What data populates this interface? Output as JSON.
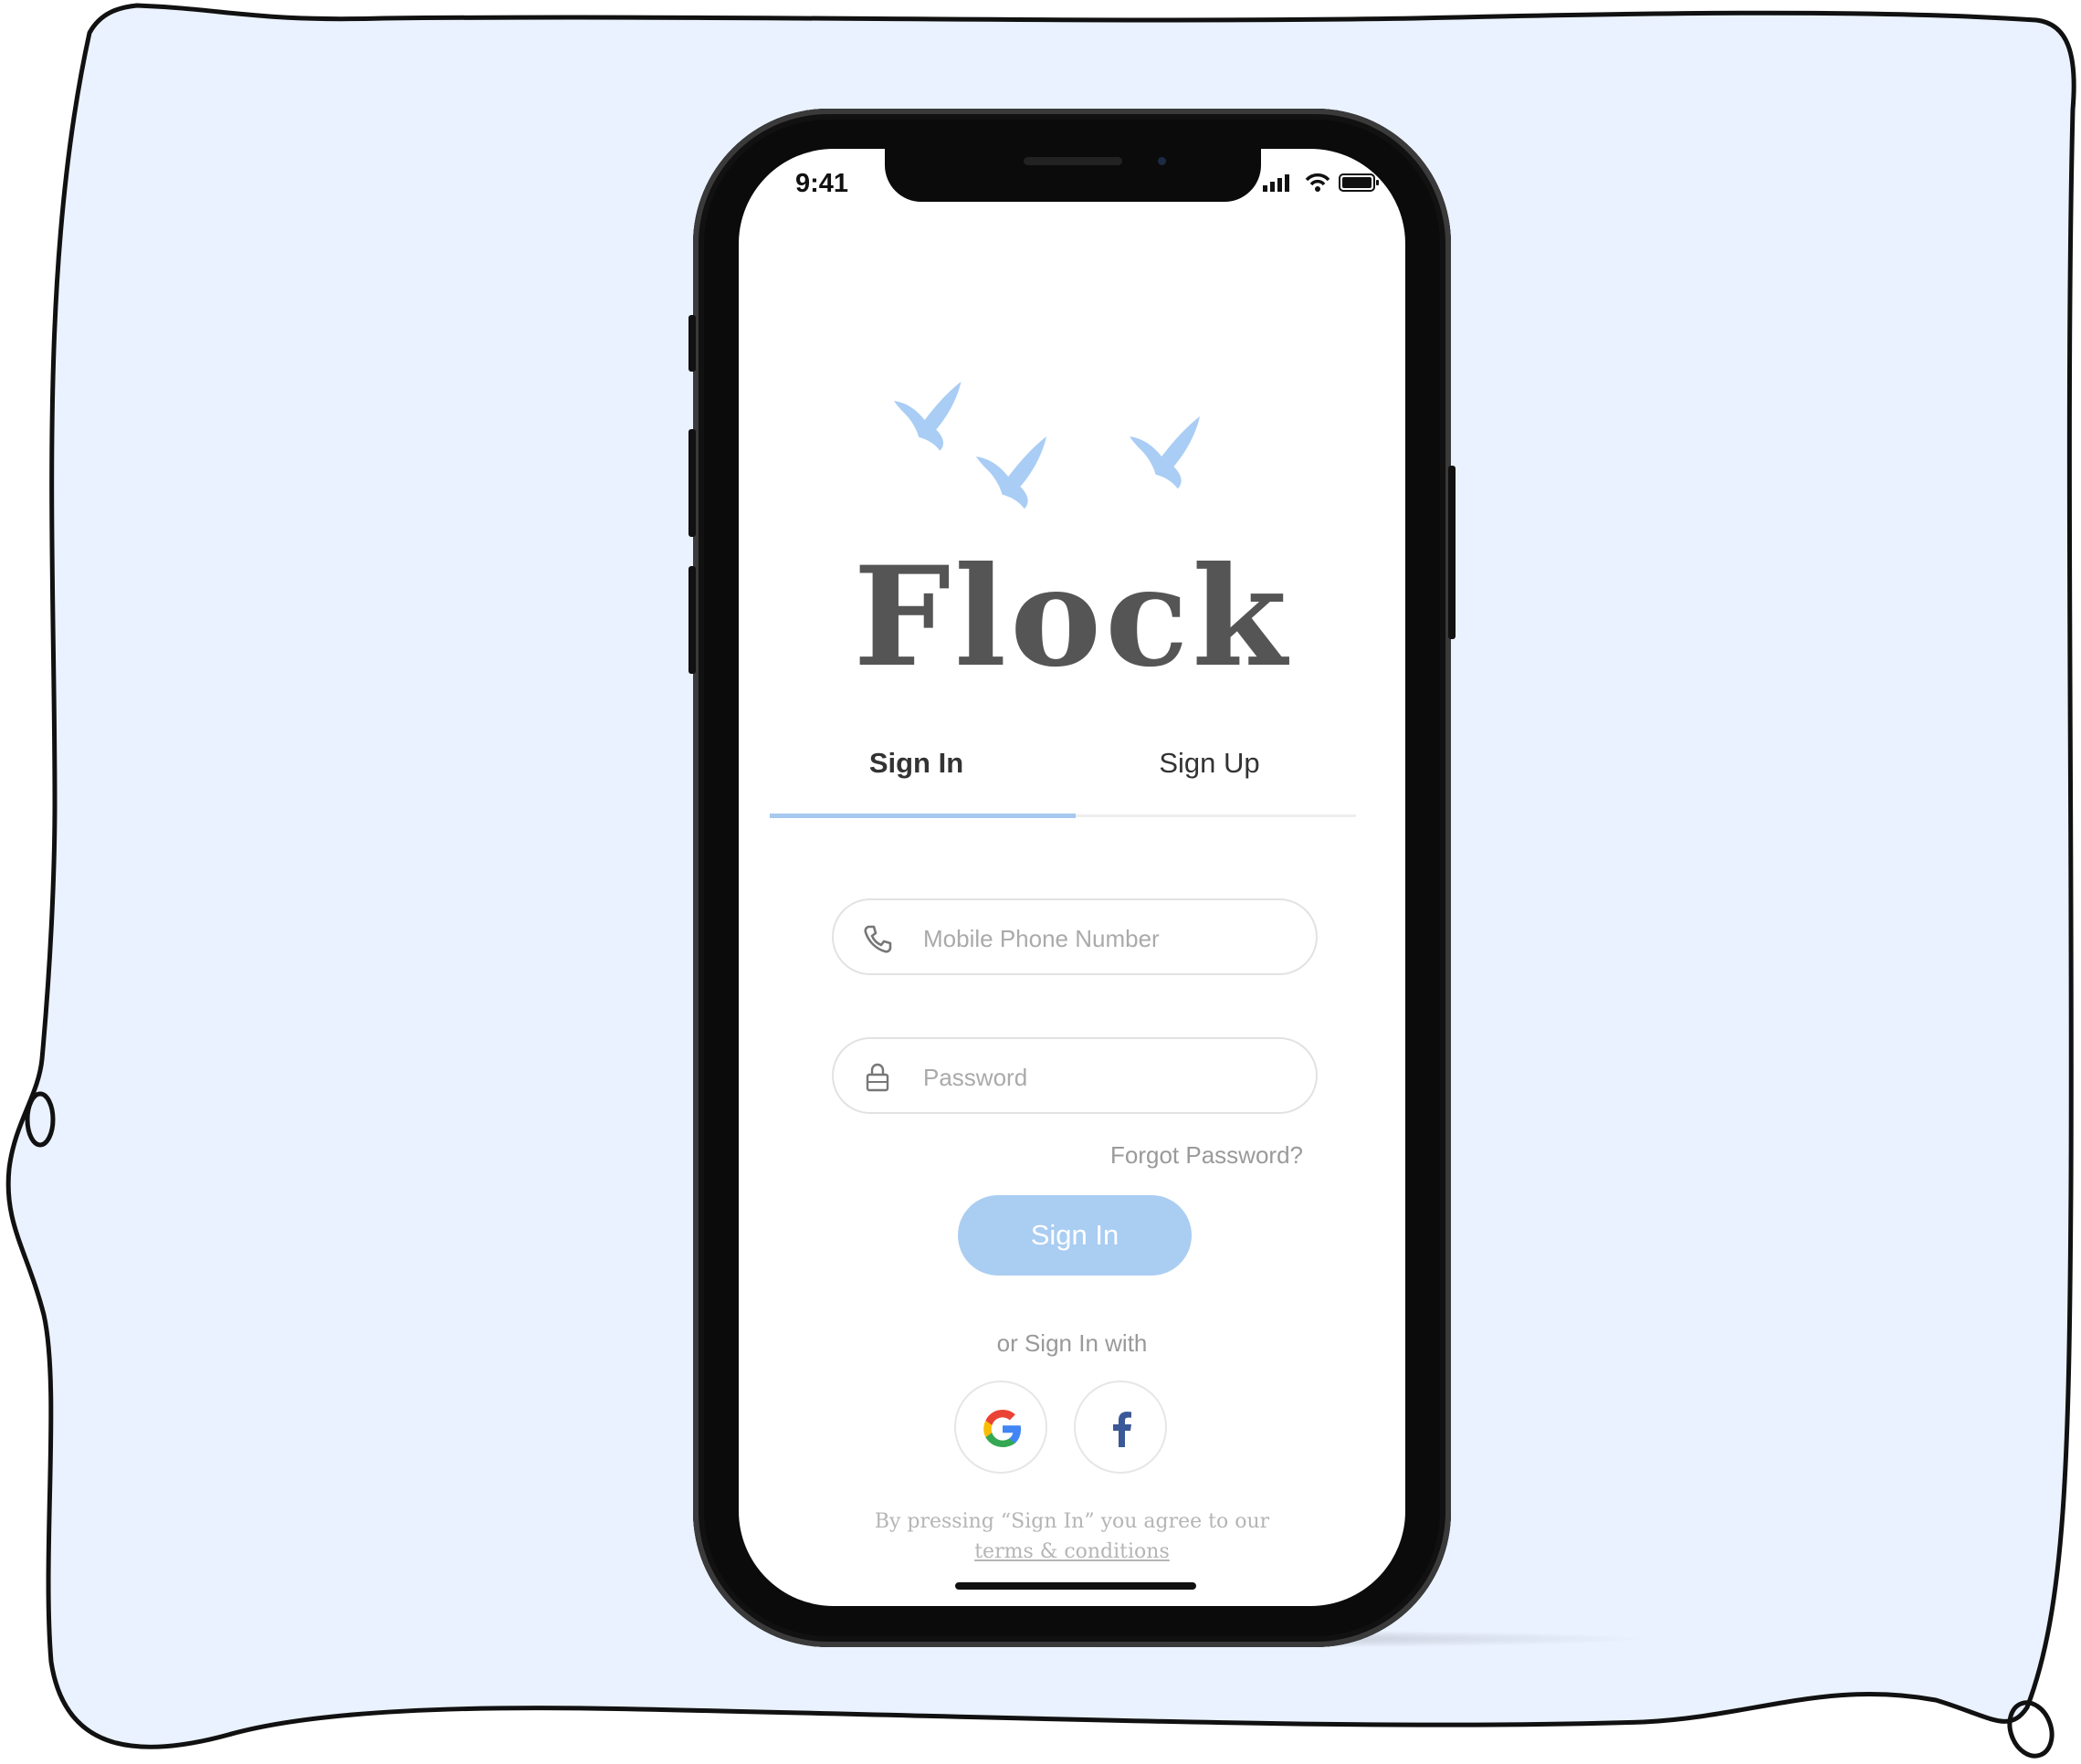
{
  "status_bar": {
    "time": "9:41"
  },
  "app": {
    "name": "Flock"
  },
  "tabs": [
    {
      "label": "Sign In",
      "active": true
    },
    {
      "label": "Sign Up",
      "active": false
    }
  ],
  "form": {
    "phone": {
      "placeholder": "Mobile Phone Number",
      "icon": "phone-icon"
    },
    "password": {
      "placeholder": "Password",
      "icon": "lock-icon"
    },
    "forgot_label": "Forgot Password?",
    "submit_label": "Sign In"
  },
  "social": {
    "heading": "or Sign In with",
    "providers": [
      {
        "name": "Google",
        "icon": "google-icon"
      },
      {
        "name": "Facebook",
        "icon": "facebook-icon"
      }
    ]
  },
  "footer": {
    "agreement": "By pressing “Sign In” you agree to our",
    "terms_link": "terms & conditions"
  },
  "colors": {
    "accent": "#a7c8ef",
    "background": "#eaf2ff",
    "logo_text": "#555555"
  }
}
